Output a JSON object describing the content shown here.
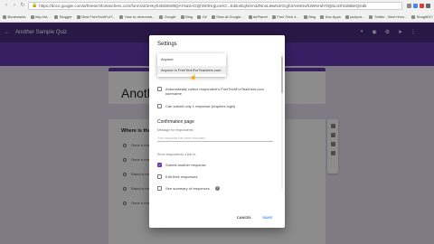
{
  "browser": {
    "url": "https://docs.google.com/a/freetechforteachers.com/forms/d/1HKyh4kl38S98QAY6aSAGQhNr0HrgUoHO...EditorEqNXm3ZNnxL9iwN4rGrgh3AvMUwfUWNHdY0Q8LoOhUd5BeQ/edit",
    "bookmarks": [
      "Bookmarks",
      "http://st...",
      "Blogger",
      "Best FreeTechForT...",
      "How to demonstr...",
      "Google",
      "Blog",
      "Oil",
      "Slow at Google...",
      "dePlanet",
      "Free Tech 4...",
      "Blog",
      "Doc Apps",
      "jackpot...",
      "Twitter - Best Hom...",
      "SnagitDIY",
      "Stream - Free T..."
    ]
  },
  "header": {
    "title": "Another Sample Quiz"
  },
  "form": {
    "title": "Another",
    "question": "Where is the",
    "options": [
      "Once a reason...",
      "Once a reason...",
      "Rated a reason...",
      "Rated a reas...",
      "Once a reas..."
    ]
  },
  "dialog": {
    "title": "Settings",
    "dropdown_options": [
      "Anyone",
      "Anyone in FreeTechForTeachers.com"
    ],
    "collect_email_label": "Automatically collect respondent's FreeTechForTeachers.com username",
    "submit_once_label": "Can submit only 1 response (requires login)",
    "confirmation_section": "Confirmation page",
    "message_label": "Message for respondents",
    "message_placeholder": "Your response has been recorded",
    "show_respondents_label": "Show respondents a link to:",
    "submit_another_label": "Submit another response",
    "edit_responses_label": "Edit their responses",
    "see_summary_label": "See summary of responses",
    "cancel": "CANCEL",
    "save": "SAVE"
  },
  "colors": {
    "header": "#4b2d7f",
    "accent": "#673ab7",
    "save": "#4285f4"
  }
}
